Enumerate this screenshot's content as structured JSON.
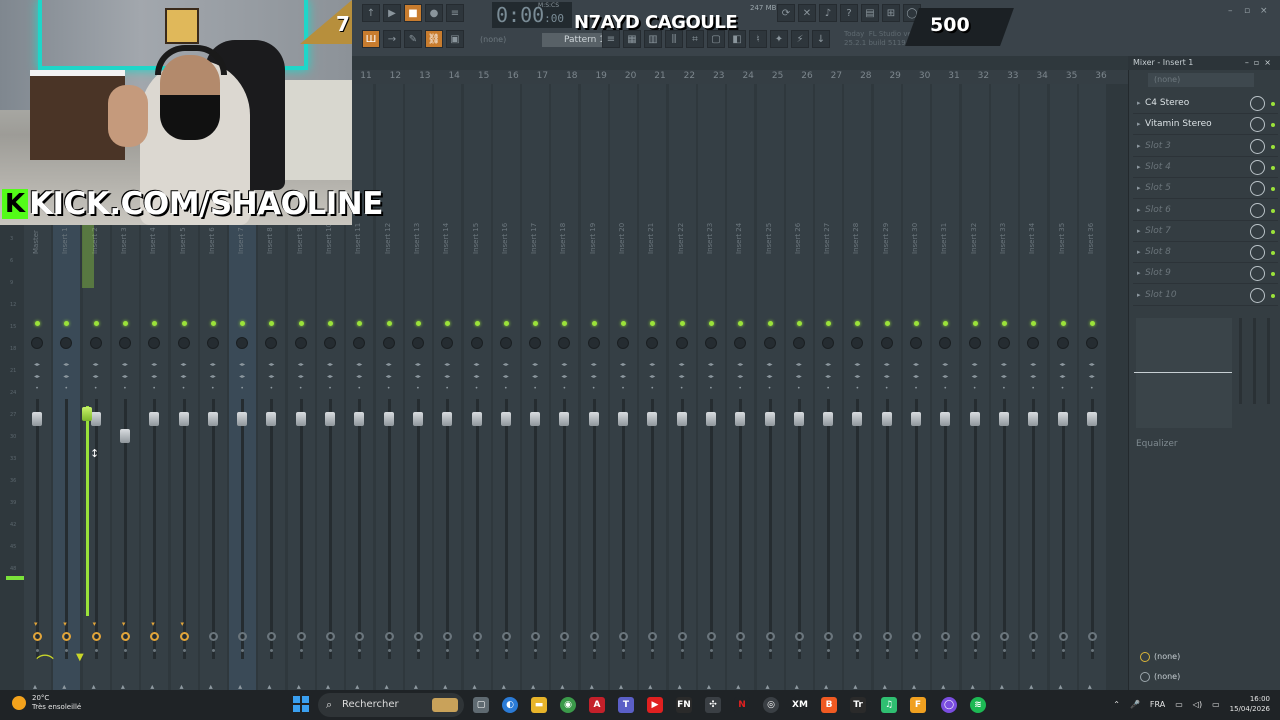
{
  "overlay": {
    "kick_url": "KICK.COM/SHAOLINE",
    "kick_letter": "K"
  },
  "toolbar": {
    "logo_number": "7",
    "clock": "0:00",
    "clock_small": ":00",
    "clock_label": "M:S:CS",
    "song_title": "N7AYD CAGOULE",
    "counter": "500",
    "pattern": "Pattern 1",
    "none_label": "(none)",
    "memory": "247 MB",
    "version_text": "Today  FL Studio version\n25.2.1 build 5119 is available"
  },
  "mixer": {
    "ruler_numbers": [
      "11",
      "12",
      "13",
      "14",
      "15",
      "16",
      "17",
      "18",
      "19",
      "20",
      "21",
      "22",
      "23",
      "24",
      "25",
      "26",
      "27",
      "28",
      "29",
      "30",
      "31",
      "32",
      "33",
      "34",
      "35",
      "36"
    ],
    "tracks": [
      "Master",
      "Insert 1",
      "Insert 2",
      "Insert 3",
      "Insert 4",
      "Insert 5",
      "Insert 6",
      "Insert 7",
      "Insert 8",
      "Insert 9",
      "Insert 10",
      "Insert 11",
      "Insert 12",
      "Insert 13",
      "Insert 14",
      "Insert 15",
      "Insert 16",
      "Insert 17",
      "Insert 18",
      "Insert 19",
      "Insert 20",
      "Insert 21",
      "Insert 22",
      "Insert 23",
      "Insert 24",
      "Insert 25",
      "Insert 26",
      "Insert 27",
      "Insert 28",
      "Insert 29",
      "Insert 30",
      "Insert 31",
      "Insert 32",
      "Insert 33",
      "Insert 34",
      "Insert 35",
      "Insert 36"
    ],
    "scale_marks": [
      "3",
      "6",
      "9",
      "12",
      "15",
      "18",
      "21",
      "24",
      "27",
      "30",
      "33",
      "36",
      "39",
      "42",
      "45",
      "48"
    ]
  },
  "insert_panel": {
    "title": "Mixer - Insert 1",
    "preset": "(none)",
    "slots": [
      {
        "label": "C4 Stereo",
        "empty": false
      },
      {
        "label": "Vitamin Stereo",
        "empty": false
      },
      {
        "label": "Slot 3",
        "empty": true
      },
      {
        "label": "Slot 4",
        "empty": true
      },
      {
        "label": "Slot 5",
        "empty": true
      },
      {
        "label": "Slot 6",
        "empty": true
      },
      {
        "label": "Slot 7",
        "empty": true
      },
      {
        "label": "Slot 8",
        "empty": true
      },
      {
        "label": "Slot 9",
        "empty": true
      },
      {
        "label": "Slot 10",
        "empty": true
      }
    ],
    "equalizer_label": "Equalizer",
    "route_in": "(none)",
    "route_out": "(none)"
  },
  "taskbar": {
    "temp": "20°C",
    "weather": "Très ensoleillé",
    "search_placeholder": "Rechercher",
    "lang": "FRA",
    "time": "16:00",
    "date": "15/04/2026"
  }
}
